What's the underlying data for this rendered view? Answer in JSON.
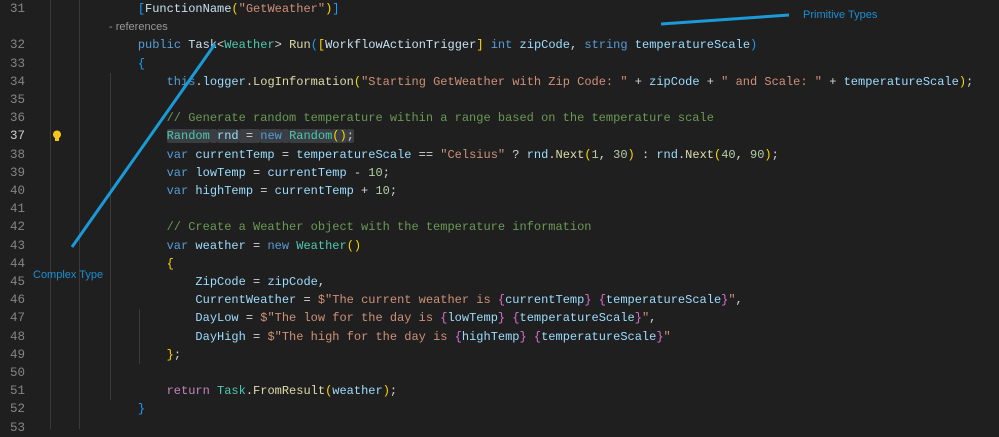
{
  "editor": {
    "codelens": "- references",
    "current_line": 37,
    "lines": [
      {
        "n": "31",
        "tokens": [
          [
            "    ",
            ""
          ],
          [
            "[",
            "b3"
          ],
          [
            "FunctionName",
            "a"
          ],
          [
            "(",
            "b1"
          ],
          [
            "\"GetWeather\"",
            "s"
          ],
          [
            ")",
            "b1"
          ],
          [
            "]",
            "b3"
          ]
        ]
      },
      {
        "n": "32",
        "tokens": [
          [
            "    ",
            ""
          ],
          [
            "public",
            "k"
          ],
          [
            " ",
            "p"
          ],
          [
            "Task",
            "a"
          ],
          [
            "<",
            "p"
          ],
          [
            "Weather",
            "t"
          ],
          [
            "> ",
            "p"
          ],
          [
            "Run",
            "f"
          ],
          [
            "(",
            "b3"
          ],
          [
            "[",
            "b1"
          ],
          [
            "WorkflowActionTrigger",
            "a"
          ],
          [
            "]",
            "b1"
          ],
          [
            " ",
            "p"
          ],
          [
            "int",
            "k"
          ],
          [
            " ",
            "p"
          ],
          [
            "zipCode",
            "v"
          ],
          [
            ", ",
            "p"
          ],
          [
            "string",
            "k"
          ],
          [
            " ",
            "p"
          ],
          [
            "temperatureScale",
            "v"
          ],
          [
            ")",
            "b3"
          ]
        ]
      },
      {
        "n": "33",
        "tokens": [
          [
            "    ",
            ""
          ],
          [
            "{",
            "b3"
          ]
        ]
      },
      {
        "n": "34",
        "tokens": [
          [
            "        ",
            ""
          ],
          [
            "this",
            "k"
          ],
          [
            ".",
            "p"
          ],
          [
            "logger",
            "v"
          ],
          [
            ".",
            "p"
          ],
          [
            "LogInformation",
            "f"
          ],
          [
            "(",
            "b1"
          ],
          [
            "\"Starting GetWeather with Zip Code: \"",
            "s"
          ],
          [
            " + ",
            "p"
          ],
          [
            "zipCode",
            "v"
          ],
          [
            " + ",
            "p"
          ],
          [
            "\" and Scale: \"",
            "s"
          ],
          [
            " + ",
            "p"
          ],
          [
            "temperatureScale",
            "v"
          ],
          [
            ")",
            "b1"
          ],
          [
            ";",
            "p"
          ]
        ]
      },
      {
        "n": "35",
        "tokens": []
      },
      {
        "n": "36",
        "tokens": [
          [
            "        ",
            ""
          ],
          [
            "// Generate random temperature within a range based on the temperature scale",
            "m"
          ]
        ]
      },
      {
        "n": "37",
        "tokens": [
          [
            "        ",
            ""
          ],
          [
            "Random",
            "t sel"
          ],
          [
            " ",
            "sel"
          ],
          [
            "rnd",
            "v sel"
          ],
          [
            " = ",
            "p sel"
          ],
          [
            "new",
            "k sel"
          ],
          [
            " ",
            "sel"
          ],
          [
            "Random",
            "t sel"
          ],
          [
            "()",
            "b1 sel"
          ],
          [
            ";",
            "p sel"
          ]
        ]
      },
      {
        "n": "38",
        "tokens": [
          [
            "        ",
            ""
          ],
          [
            "var",
            "k"
          ],
          [
            " ",
            "p"
          ],
          [
            "currentTemp",
            "v"
          ],
          [
            " = ",
            "p"
          ],
          [
            "temperatureScale",
            "v"
          ],
          [
            " == ",
            "p"
          ],
          [
            "\"Celsius\"",
            "s"
          ],
          [
            " ? ",
            "p"
          ],
          [
            "rnd",
            "v"
          ],
          [
            ".",
            "p"
          ],
          [
            "Next",
            "f"
          ],
          [
            "(",
            "b1"
          ],
          [
            "1",
            "n"
          ],
          [
            ", ",
            "p"
          ],
          [
            "30",
            "n"
          ],
          [
            ")",
            "b1"
          ],
          [
            " : ",
            "p"
          ],
          [
            "rnd",
            "v"
          ],
          [
            ".",
            "p"
          ],
          [
            "Next",
            "f"
          ],
          [
            "(",
            "b1"
          ],
          [
            "40",
            "n"
          ],
          [
            ", ",
            "p"
          ],
          [
            "90",
            "n"
          ],
          [
            ")",
            "b1"
          ],
          [
            ";",
            "p"
          ]
        ]
      },
      {
        "n": "39",
        "tokens": [
          [
            "        ",
            ""
          ],
          [
            "var",
            "k"
          ],
          [
            " ",
            "p"
          ],
          [
            "lowTemp",
            "v"
          ],
          [
            " = ",
            "p"
          ],
          [
            "currentTemp",
            "v"
          ],
          [
            " - ",
            "p"
          ],
          [
            "10",
            "n"
          ],
          [
            ";",
            "p"
          ]
        ]
      },
      {
        "n": "40",
        "tokens": [
          [
            "        ",
            ""
          ],
          [
            "var",
            "k"
          ],
          [
            " ",
            "p"
          ],
          [
            "highTemp",
            "v"
          ],
          [
            " = ",
            "p"
          ],
          [
            "currentTemp",
            "v"
          ],
          [
            " + ",
            "p"
          ],
          [
            "10",
            "n"
          ],
          [
            ";",
            "p"
          ]
        ]
      },
      {
        "n": "41",
        "tokens": []
      },
      {
        "n": "42",
        "tokens": [
          [
            "        ",
            ""
          ],
          [
            "// Create a Weather object with the temperature information",
            "m"
          ]
        ]
      },
      {
        "n": "43",
        "tokens": [
          [
            "        ",
            ""
          ],
          [
            "var",
            "k"
          ],
          [
            " ",
            "p"
          ],
          [
            "weather",
            "v"
          ],
          [
            " = ",
            "p"
          ],
          [
            "new",
            "k"
          ],
          [
            " ",
            "p"
          ],
          [
            "Weather",
            "t"
          ],
          [
            "()",
            "b1"
          ]
        ]
      },
      {
        "n": "44",
        "tokens": [
          [
            "        ",
            ""
          ],
          [
            "{",
            "b1"
          ]
        ]
      },
      {
        "n": "45",
        "tokens": [
          [
            "            ",
            ""
          ],
          [
            "ZipCode",
            "v"
          ],
          [
            " = ",
            "p"
          ],
          [
            "zipCode",
            "v"
          ],
          [
            ",",
            "p"
          ]
        ]
      },
      {
        "n": "46",
        "tokens": [
          [
            "            ",
            ""
          ],
          [
            "CurrentWeather",
            "v"
          ],
          [
            " = ",
            "p"
          ],
          [
            "$\"The current weather is ",
            "s"
          ],
          [
            "{",
            "b2"
          ],
          [
            "currentTemp",
            "v"
          ],
          [
            "}",
            "b2"
          ],
          [
            " ",
            "s"
          ],
          [
            "{",
            "b2"
          ],
          [
            "temperatureScale",
            "v"
          ],
          [
            "}",
            "b2"
          ],
          [
            "\"",
            "s"
          ],
          [
            ",",
            "p"
          ]
        ]
      },
      {
        "n": "47",
        "tokens": [
          [
            "            ",
            ""
          ],
          [
            "DayLow",
            "v"
          ],
          [
            " = ",
            "p"
          ],
          [
            "$\"The low for the day is ",
            "s"
          ],
          [
            "{",
            "b2"
          ],
          [
            "lowTemp",
            "v"
          ],
          [
            "}",
            "b2"
          ],
          [
            " ",
            "s"
          ],
          [
            "{",
            "b2"
          ],
          [
            "temperatureScale",
            "v"
          ],
          [
            "}",
            "b2"
          ],
          [
            "\"",
            "s"
          ],
          [
            ",",
            "p"
          ]
        ]
      },
      {
        "n": "48",
        "tokens": [
          [
            "            ",
            ""
          ],
          [
            "DayHigh",
            "v"
          ],
          [
            " = ",
            "p"
          ],
          [
            "$\"The high for the day is ",
            "s"
          ],
          [
            "{",
            "b2"
          ],
          [
            "highTemp",
            "v"
          ],
          [
            "}",
            "b2"
          ],
          [
            " ",
            "s"
          ],
          [
            "{",
            "b2"
          ],
          [
            "temperatureScale",
            "v"
          ],
          [
            "}",
            "b2"
          ],
          [
            "\"",
            "s"
          ]
        ]
      },
      {
        "n": "49",
        "tokens": [
          [
            "        ",
            ""
          ],
          [
            "}",
            "b1"
          ],
          [
            ";",
            "p"
          ]
        ]
      },
      {
        "n": "50",
        "tokens": []
      },
      {
        "n": "51",
        "tokens": [
          [
            "        ",
            ""
          ],
          [
            "return",
            "c"
          ],
          [
            " ",
            "p"
          ],
          [
            "Task",
            "t"
          ],
          [
            ".",
            "p"
          ],
          [
            "FromResult",
            "f"
          ],
          [
            "(",
            "b1"
          ],
          [
            "weather",
            "v"
          ],
          [
            ")",
            "b1"
          ],
          [
            ";",
            "p"
          ]
        ]
      },
      {
        "n": "52",
        "tokens": [
          [
            "    ",
            ""
          ],
          [
            "}",
            "b3"
          ]
        ]
      },
      {
        "n": "53",
        "tokens": []
      }
    ]
  },
  "annotations": {
    "primitive": "Primitive Types",
    "complex": "Complex Type",
    "color": "#1a9ad6"
  },
  "icons": {
    "lightbulb": "lightbulb-icon"
  }
}
